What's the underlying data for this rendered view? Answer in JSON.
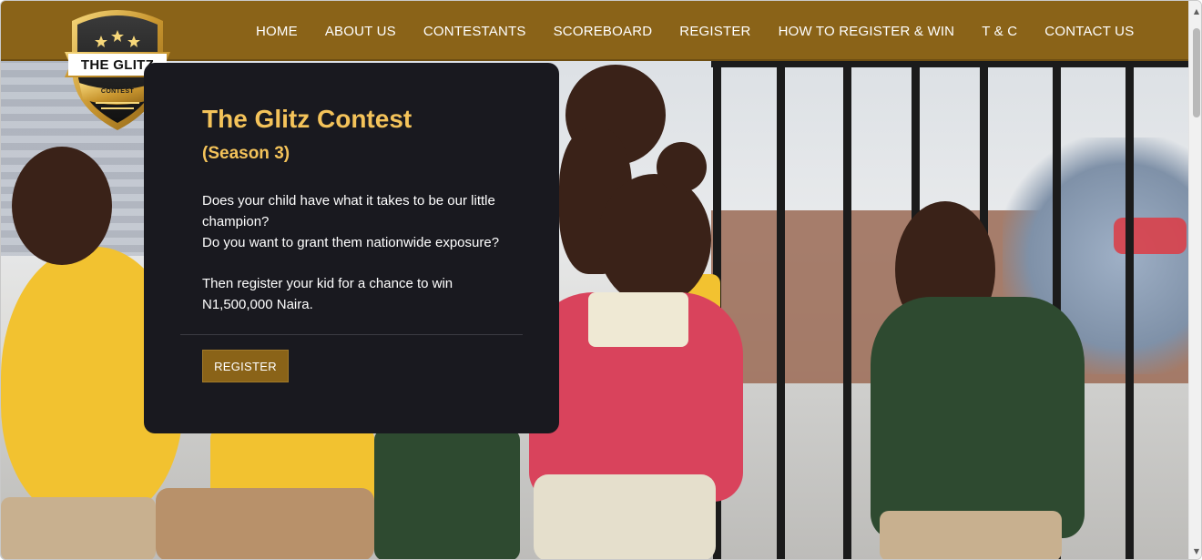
{
  "nav": {
    "items": [
      {
        "label": "HOME"
      },
      {
        "label": "ABOUT US"
      },
      {
        "label": "CONTESTANTS"
      },
      {
        "label": "SCOREBOARD"
      },
      {
        "label": "REGISTER"
      },
      {
        "label": "HOW TO REGISTER & WIN"
      },
      {
        "label": "T & C"
      },
      {
        "label": "CONTACT US"
      }
    ]
  },
  "logo": {
    "top_text": "THE GLITZ",
    "bottom_text": "CONTEST",
    "icon": "shield-crest-icon"
  },
  "hero": {
    "title": "The Glitz Contest",
    "subtitle": "(Season 3)",
    "line1": "Does your child have what it takes to be our little champion?",
    "line2": "Do you want to grant them nationwide exposure?",
    "line3": "Then register your kid for a chance to win N1,500,000 Naira.",
    "button_label": "REGISTER",
    "image_subject": "children running photo"
  },
  "colors": {
    "brand_gold": "#8a6318",
    "title_gold": "#f4c35a",
    "card_bg": "#19191f"
  }
}
